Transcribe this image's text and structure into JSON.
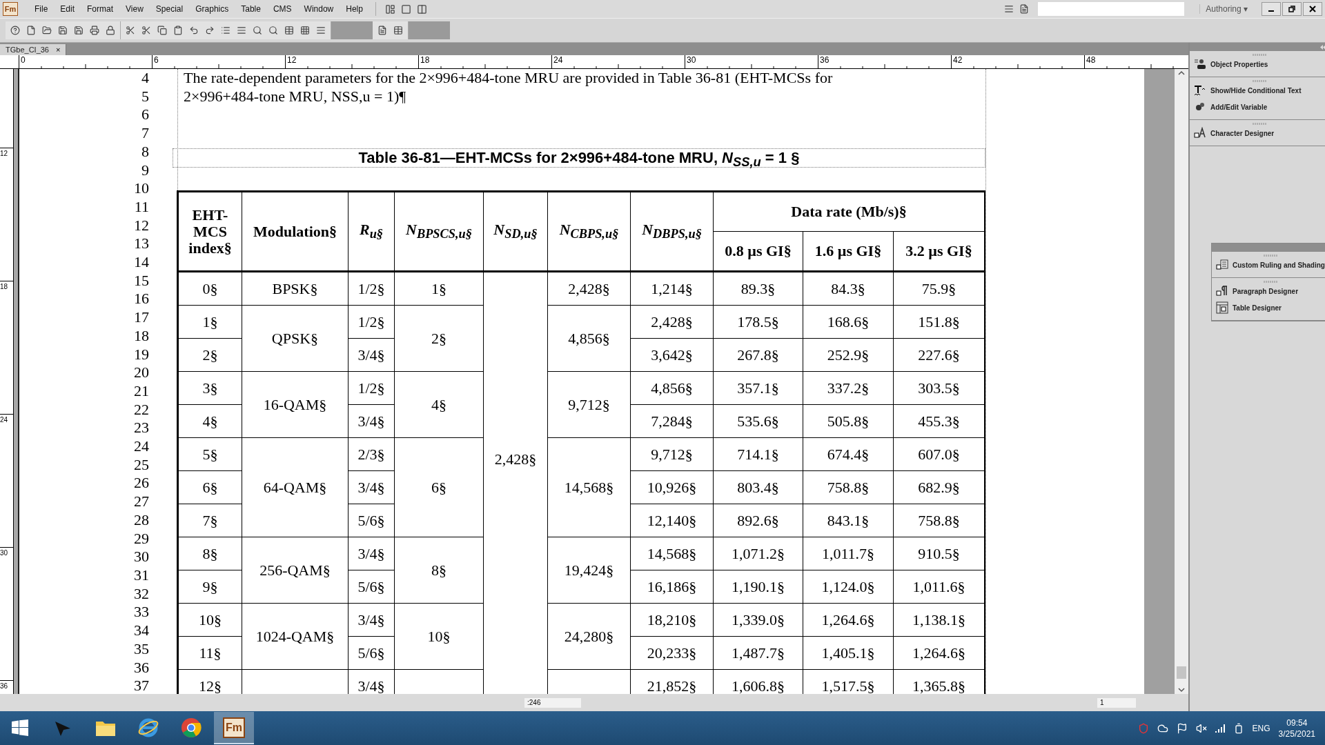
{
  "app": {
    "logo": "Fm",
    "menu": [
      "File",
      "Edit",
      "Format",
      "View",
      "Special",
      "Graphics",
      "Table",
      "CMS",
      "Window",
      "Help"
    ],
    "mode": "Authoring ▾"
  },
  "document_tab": {
    "title": "TGbe_CI_36",
    "close": "×"
  },
  "ruler": {
    "marks": [
      "0",
      "6",
      "12",
      "18",
      "24",
      "30",
      "36",
      "42",
      "48"
    ]
  },
  "vertical_ruler": {
    "marks": [
      "12",
      "18",
      "24",
      "30",
      "36"
    ]
  },
  "line_numbers": [
    "4",
    "5",
    "6",
    "7",
    "8",
    "9",
    "10",
    "11",
    "12",
    "13",
    "14",
    "15",
    "16",
    "17",
    "18",
    "19",
    "20",
    "21",
    "22",
    "23",
    "24",
    "25",
    "26",
    "27",
    "28",
    "29",
    "30",
    "31",
    "32",
    "33",
    "34",
    "35",
    "36",
    "37"
  ],
  "paragraph": [
    "The rate-dependent parameters for the 2×996+484-tone MRU are provided in Table 36-81 (EHT-MCSs for",
    "2×996+484-tone MRU, NSS,u = 1)¶"
  ],
  "caption": "Table 36-81—EHT-MCSs for 2×996+484-tone MRU, *N*$_{SS,u}$ = 1 §",
  "table": {
    "columns": [
      {
        "label": "EHT-MCS index§",
        "kind": "word"
      },
      {
        "label": "Modulation§",
        "kind": "word"
      },
      {
        "label": "R$_{u§}$",
        "kind": "symbol"
      },
      {
        "label": "N$_{BPSCS,u§}$",
        "kind": "symbol"
      },
      {
        "label": "N$_{SD,u§}$",
        "kind": "symbol"
      },
      {
        "label": "N$_{CBPS,u§}$",
        "kind": "symbol"
      },
      {
        "label": "N$_{DBPS,u§}$",
        "kind": "symbol"
      }
    ],
    "data_rate": {
      "title": "Data rate (Mb/s)§",
      "columns": [
        "0.8 µs GI§",
        "1.6 µs GI§",
        "3.2 µs GI§"
      ]
    },
    "n_sd": "2,428§",
    "groups": [
      {
        "modulation": "BPSK§",
        "n_bpscs": "1§",
        "n_cbps": "2,428§",
        "rows": [
          {
            "index": "0§",
            "rate": "1/2§",
            "n_dbps": "1,214§",
            "rates": [
              "89.3§",
              "84.3§",
              "75.9§"
            ]
          }
        ]
      },
      {
        "modulation": "QPSK§",
        "n_bpscs": "2§",
        "n_cbps": "4,856§",
        "rows": [
          {
            "index": "1§",
            "rate": "1/2§",
            "n_dbps": "2,428§",
            "rates": [
              "178.5§",
              "168.6§",
              "151.8§"
            ]
          },
          {
            "index": "2§",
            "rate": "3/4§",
            "n_dbps": "3,642§",
            "rates": [
              "267.8§",
              "252.9§",
              "227.6§"
            ]
          }
        ]
      },
      {
        "modulation": "16-QAM§",
        "n_bpscs": "4§",
        "n_cbps": "9,712§",
        "rows": [
          {
            "index": "3§",
            "rate": "1/2§",
            "n_dbps": "4,856§",
            "rates": [
              "357.1§",
              "337.2§",
              "303.5§"
            ]
          },
          {
            "index": "4§",
            "rate": "3/4§",
            "n_dbps": "7,284§",
            "rates": [
              "535.6§",
              "505.8§",
              "455.3§"
            ]
          }
        ]
      },
      {
        "modulation": "64-QAM§",
        "n_bpscs": "6§",
        "n_cbps": "14,568§",
        "rows": [
          {
            "index": "5§",
            "rate": "2/3§",
            "n_dbps": "9,712§",
            "rates": [
              "714.1§",
              "674.4§",
              "607.0§"
            ]
          },
          {
            "index": "6§",
            "rate": "3/4§",
            "n_dbps": "10,926§",
            "rates": [
              "803.4§",
              "758.8§",
              "682.9§"
            ]
          },
          {
            "index": "7§",
            "rate": "5/6§",
            "n_dbps": "12,140§",
            "rates": [
              "892.6§",
              "843.1§",
              "758.8§"
            ]
          }
        ]
      },
      {
        "modulation": "256-QAM§",
        "n_bpscs": "8§",
        "n_cbps": "19,424§",
        "rows": [
          {
            "index": "8§",
            "rate": "3/4§",
            "n_dbps": "14,568§",
            "rates": [
              "1,071.2§",
              "1,011.7§",
              "910.5§"
            ]
          },
          {
            "index": "9§",
            "rate": "5/6§",
            "n_dbps": "16,186§",
            "rates": [
              "1,190.1§",
              "1,124.0§",
              "1,011.6§"
            ]
          }
        ]
      },
      {
        "modulation": "1024-QAM§",
        "n_bpscs": "10§",
        "n_cbps": "24,280§",
        "rows": [
          {
            "index": "10§",
            "rate": "3/4§",
            "n_dbps": "18,210§",
            "rates": [
              "1,339.0§",
              "1,264.6§",
              "1,138.1§"
            ]
          },
          {
            "index": "11§",
            "rate": "5/6§",
            "n_dbps": "20,233§",
            "rates": [
              "1,487.7§",
              "1,405.1§",
              "1,264.6§"
            ]
          }
        ]
      },
      {
        "rows": [
          {
            "index": "12§",
            "rate": "3/4§",
            "n_dbps": "21,852§",
            "rates": [
              "1,606.8§",
              "1,517.5§",
              "1,365.8§"
            ]
          }
        ]
      }
    ]
  },
  "status_bar": {
    "position": ":246",
    "page": "1"
  },
  "panel": {
    "groups": [
      [
        {
          "label": "Object Properties",
          "kind": "properties"
        }
      ],
      [
        {
          "label": "Show/Hide Conditional Text",
          "kind": "conditional"
        },
        {
          "label": "Add/Edit Variable",
          "kind": "variable"
        }
      ],
      [
        {
          "label": "Character Designer",
          "kind": "character"
        }
      ]
    ],
    "floating_groups": [
      [
        {
          "label": "Custom Ruling and Shading",
          "kind": "ruling"
        }
      ],
      [
        {
          "label": "Paragraph Designer",
          "kind": "paragraph"
        },
        {
          "label": "Table Designer",
          "kind": "table"
        }
      ]
    ]
  },
  "taskbar": {
    "apps": [
      {
        "kind": "pointer",
        "selected": false
      },
      {
        "kind": "folder",
        "selected": false
      },
      {
        "kind": "browser",
        "selected": false
      },
      {
        "kind": "chrome",
        "selected": false
      },
      {
        "kind": "framemaker",
        "label": "Fm",
        "selected": true
      }
    ],
    "language": "ENG",
    "time": "09:54",
    "date": "3/25/2021"
  }
}
